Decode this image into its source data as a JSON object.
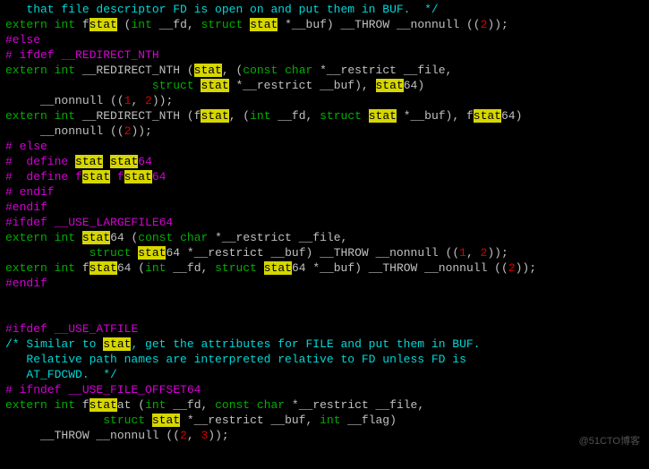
{
  "lines": {
    "l01a": "   that file descriptor FD is open on and put them in BUF.  */",
    "l02a": "extern",
    "l02b": " int",
    "l02c": " f",
    "l02d": "stat",
    "l02e": " (",
    "l02f": "int",
    "l02g": " __fd, ",
    "l02h": "struct",
    "l02i": " ",
    "l02j": "stat",
    "l02k": " *__buf) __THROW __nonnull ((",
    "l02l": "2",
    "l02m": "));",
    "l03a": "#else",
    "l04a": "# ifdef __REDIRECT_NTH",
    "l05a": "extern",
    "l05b": " int",
    "l05c": " __REDIRECT_NTH (",
    "l05d": "stat",
    "l05e": ", (",
    "l05f": "const",
    "l05g": " char",
    "l05h": " *__restrict __file,",
    "l06a": "                     ",
    "l06b": "struct",
    "l06c": " ",
    "l06d": "stat",
    "l06e": " *__restrict __buf), ",
    "l06f": "stat",
    "l06g": "64)",
    "l07a": "     __nonnull ((",
    "l07b": "1",
    "l07c": ", ",
    "l07d": "2",
    "l07e": "));",
    "l08a": "extern",
    "l08b": " int",
    "l08c": " __REDIRECT_NTH (f",
    "l08d": "stat",
    "l08e": ", (",
    "l08f": "int",
    "l08g": " __fd, ",
    "l08h": "struct",
    "l08i": " ",
    "l08j": "stat",
    "l08k": " *__buf), f",
    "l08l": "stat",
    "l08m": "64)",
    "l09a": "     __nonnull ((",
    "l09b": "2",
    "l09c": "));",
    "l10a": "# else",
    "l11a": "#  define ",
    "l11b": "stat",
    "l11c": " ",
    "l11d": "stat",
    "l11e": "64",
    "l12a": "#  define f",
    "l12b": "stat",
    "l12c": " f",
    "l12d": "stat",
    "l12e": "64",
    "l13a": "# endif",
    "l14a": "#endif",
    "l15a": "#ifdef __USE_LARGEFILE64",
    "l16a": "extern",
    "l16b": " int",
    "l16c": " ",
    "l16d": "stat",
    "l16e": "64 (",
    "l16f": "const",
    "l16g": " char",
    "l16h": " *__restrict __file,",
    "l17a": "            ",
    "l17b": "struct",
    "l17c": " ",
    "l17d": "stat",
    "l17e": "64 *__restrict __buf) __THROW __nonnull ((",
    "l17f": "1",
    "l17g": ", ",
    "l17h": "2",
    "l17i": "));",
    "l18a": "extern",
    "l18b": " int",
    "l18c": " f",
    "l18d": "stat",
    "l18e": "64 (",
    "l18f": "int",
    "l18g": " __fd, ",
    "l18h": "struct",
    "l18i": " ",
    "l18j": "stat",
    "l18k": "64 *__buf) __THROW __nonnull ((",
    "l18l": "2",
    "l18m": "));",
    "l19a": "#endif",
    "l20a": " ",
    "l21a": " ",
    "l22a": "#ifdef __USE_ATFILE",
    "l23a": "/* Similar to ",
    "l23b": "stat",
    "l23c": ", get the attributes for FILE and put them in BUF.",
    "l24a": "   Relative path names are interpreted relative to FD unless FD is",
    "l25a": "   AT_FDCWD.  */",
    "l26a": "# ifndef __USE_FILE_OFFSET64",
    "l27a": "extern",
    "l27b": " int",
    "l27c": " f",
    "l27d": "stat",
    "l27e": "at (",
    "l27f": "int",
    "l27g": " __fd, ",
    "l27h": "const",
    "l27i": " char",
    "l27j": " *__restrict __file,",
    "l28a": "              ",
    "l28b": "struct",
    "l28c": " ",
    "l28d": "stat",
    "l28e": " *__restrict __buf, ",
    "l28f": "int",
    "l28g": " __flag)",
    "l29a": "     __THROW __nonnull ((",
    "l29b": "2",
    "l29c": ", ",
    "l29d": "3",
    "l29e": "));"
  },
  "watermark": "@51CTO博客"
}
